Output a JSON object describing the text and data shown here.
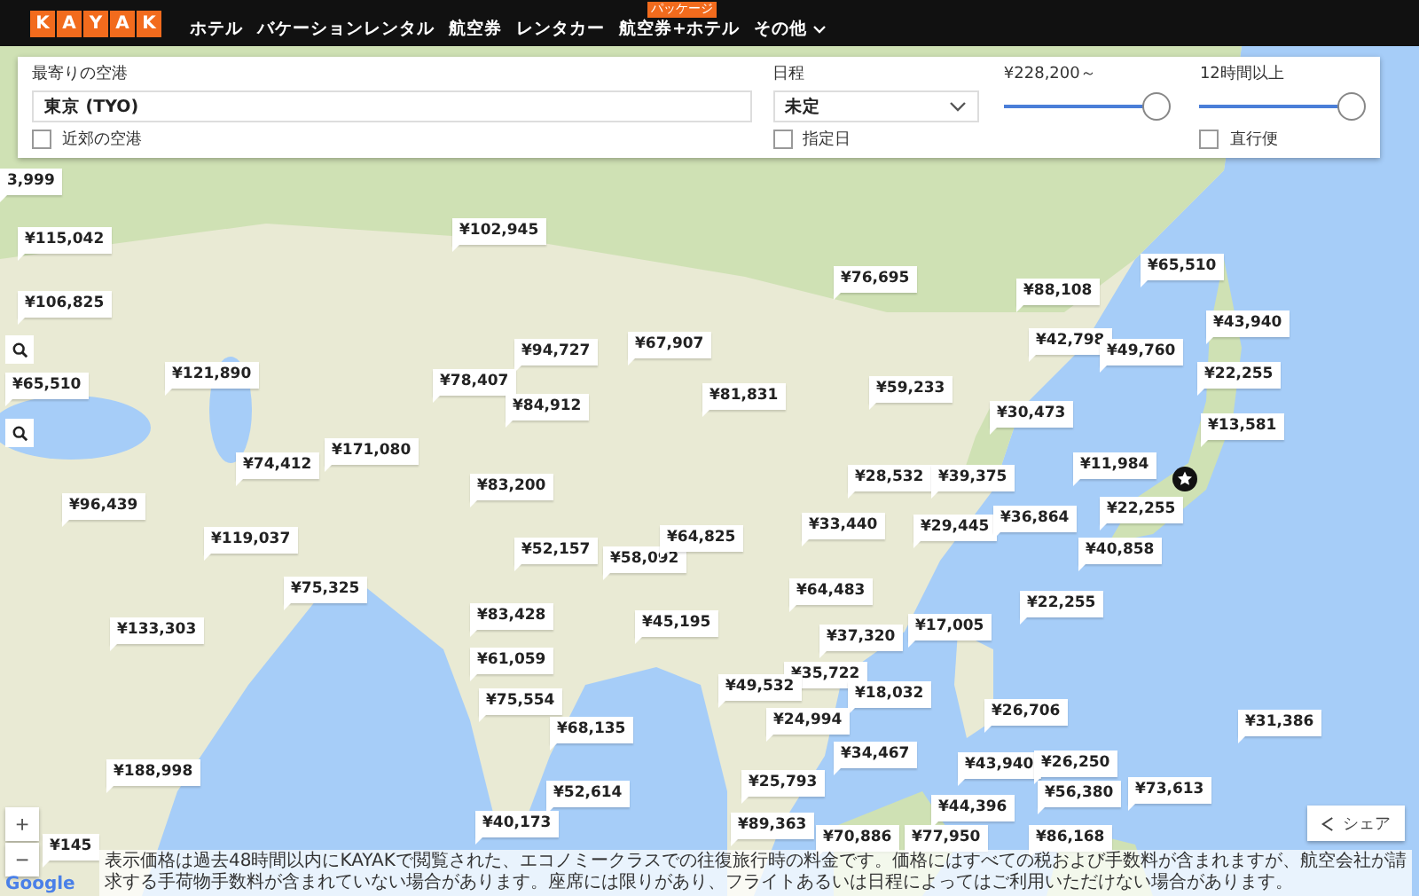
{
  "header": {
    "logo": [
      "K",
      "A",
      "Y",
      "A",
      "K"
    ],
    "nav": [
      {
        "label": "ホテル",
        "dropdown": false
      },
      {
        "label": "バケーションレンタル",
        "dropdown": false
      },
      {
        "label": "航空券",
        "dropdown": false
      },
      {
        "label": "レンタカー",
        "dropdown": false
      },
      {
        "label": "航空券+ホテル",
        "badge": "パッケージ",
        "dropdown": false
      },
      {
        "label": "その他",
        "dropdown": true
      }
    ]
  },
  "filters": {
    "airport": {
      "label": "最寄りの空港",
      "value": "東京 (TYO)",
      "checkbox": {
        "label": "近郊の空港",
        "checked": false
      }
    },
    "dates": {
      "label": "日程",
      "value": "未定",
      "checkbox": {
        "label": "指定日",
        "checked": false
      }
    },
    "price": {
      "label": "¥228,200～",
      "level": 1
    },
    "duration": {
      "label": "12時間以上",
      "level": 1,
      "checkbox": {
        "label": "直行便",
        "checked": false
      }
    }
  },
  "map": {
    "prices": [
      "3,999",
      "¥115,042",
      "¥106,825",
      "¥65,510",
      "¥102,945",
      "¥94,727",
      "¥67,907",
      "¥121,890",
      "¥78,407",
      "¥84,912",
      "¥74,412",
      "¥171,080",
      "¥83,200",
      "¥96,439",
      "¥119,037",
      "¥75,325",
      "¥133,303",
      "¥83,428",
      "¥52,157",
      "¥58,092",
      "¥64,825",
      "¥45,195",
      "¥61,059",
      "¥75,554",
      "¥68,135",
      "¥188,998",
      "¥52,614",
      "¥40,173",
      "¥145",
      "¥76,695",
      "¥88,108",
      "¥65,510",
      "¥43,940",
      "¥42,798",
      "¥49,760",
      "¥22,255",
      "¥81,831",
      "¥59,233",
      "¥30,473",
      "¥13,581",
      "¥28,532",
      "¥39,375",
      "¥11,984",
      "¥33,440",
      "¥29,445",
      "¥36,864",
      "¥22,255",
      "¥40,858",
      "¥64,483",
      "¥22,255",
      "¥17,005",
      "¥37,320",
      "¥35,722",
      "¥49,532",
      "¥18,032",
      "¥24,994",
      "¥26,706",
      "¥31,386",
      "¥34,467",
      "¥43,940",
      "¥26,250",
      "¥25,793",
      "¥56,380",
      "¥73,613",
      "¥44,396",
      "¥89,363",
      "¥70,886",
      "¥77,950",
      "¥86,168"
    ],
    "zoom_in": "+",
    "zoom_out": "−",
    "attribution": "Google",
    "share": "シェア",
    "disclaimer": "表示価格は過去48時間以内にKAYAKで閲覧された、エコノミークラスでの往復旅行時の料金です。価格にはすべての税および手数料が含まれますが、航空会社が請求する手荷物手数料が含まれていない場合があります。座席には限りがあり、フライトあるいは日程によってはご利用いただけない場合があります。"
  }
}
